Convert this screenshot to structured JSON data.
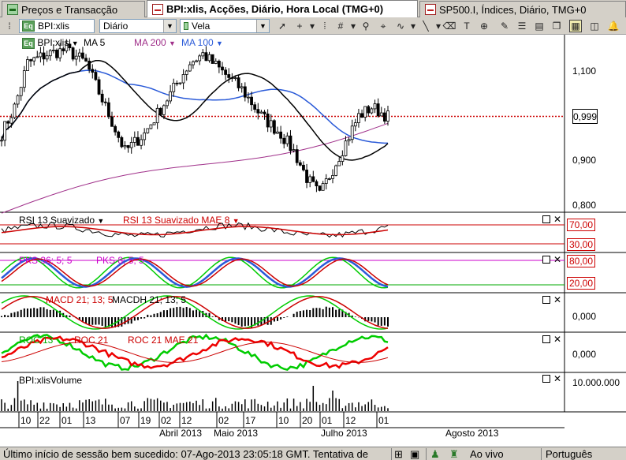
{
  "tabs": [
    {
      "label": "Preços e Transacção",
      "icon": "quote-table-icon"
    },
    {
      "label": "BPI:xlis, Acções, Diário, Hora Local (TMG+0)",
      "icon": "chart-icon",
      "active": true
    },
    {
      "label": "SP500.I, Índices, Diário, TMG+0",
      "icon": "chart-icon"
    }
  ],
  "toolbar": {
    "symbol": "BPI:xlis",
    "period": "Diário",
    "chart_type": "Vela",
    "tools": [
      "cursor-icon",
      "crosshair-icon",
      "bars-icon",
      "grid-icon",
      "zoom-icon",
      "draw-select-icon",
      "wave-icon",
      "trendline-icon",
      "eraser-icon",
      "text-tool-icon",
      "cycle-icon",
      "brush-icon",
      "level-icon",
      "note-icon",
      "copy-icon",
      "chart-settings-icon",
      "indicator-icon",
      "bell-icon"
    ]
  },
  "main_panel": {
    "symbol_label": "BPI:xlis",
    "indicators": [
      {
        "label": "MA 5",
        "color": "#000000"
      },
      {
        "label": "MA 200",
        "color": "#a0308a"
      },
      {
        "label": "MA 100",
        "color": "#2a5ad8"
      }
    ],
    "y_axis_labels": [
      "1,100",
      "0,999",
      "0,900",
      "0,800"
    ],
    "last_price": "0,999",
    "reference_price": 0.999
  },
  "rsi_panel": {
    "labels": [
      "RSI 13 Suavizado",
      "RSI 13 Suavizado MAE 8"
    ],
    "levels": [
      "70,00",
      "30,00"
    ]
  },
  "pks_panel": {
    "labels": [
      "PKS 36; 5; 5",
      "PKS 8; 5; 5"
    ],
    "levels": [
      "80,00",
      "20,00"
    ]
  },
  "macd_panel": {
    "labels": [
      "MACD 21; 13; 5",
      "MACDH 21; 13; 5"
    ],
    "axis_label": "0,000"
  },
  "roc_panel": {
    "labels": [
      "ROC 13",
      "ROC 21",
      "ROC 21 MAE 21"
    ],
    "axis_label": "0,000"
  },
  "volume_panel": {
    "label": "BPI:xlisVolume",
    "axis_label": "10.000.000"
  },
  "time_axis": {
    "days": [
      "10",
      "22",
      "01",
      "13",
      "07",
      "19",
      "02",
      "12",
      "02",
      "17",
      "10",
      "20",
      "01",
      "12",
      "01"
    ],
    "months": [
      "Abril 2013",
      "Maio 2013",
      "Julho 2013",
      "Agosto 2013"
    ]
  },
  "statusbar": {
    "message": "Último início de sessão bem sucedido: 07-Ago-2013 23:05:18 GMT. Tentativa de",
    "connection": "Ao vivo",
    "language": "Português"
  },
  "colors": {
    "up": "#ffffff",
    "down": "#000000",
    "ma_long": "#a0308a",
    "ma_mid": "#2a5ad8",
    "reference_line": "#cc0000",
    "macd_up": "#00cc00",
    "macd_down": "#cc0000"
  }
}
